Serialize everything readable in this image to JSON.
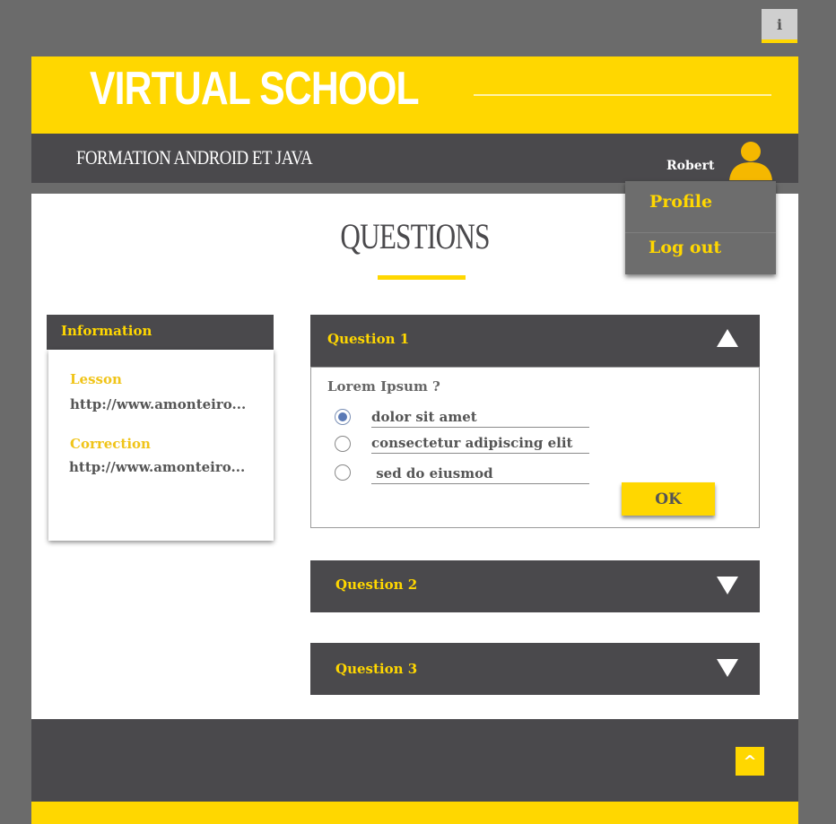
{
  "header": {
    "info_label": "i",
    "brand": "VIRTUAL SCHOOL",
    "course_title": "FORMATION ANDROID ET JAVA",
    "username": "Robert",
    "avatar_icon": "user-silhouette-icon"
  },
  "user_menu": {
    "items": [
      {
        "label": "Profile"
      },
      {
        "label": "Log out"
      }
    ]
  },
  "page": {
    "title": "QUESTIONS"
  },
  "info_panel": {
    "heading": "Information",
    "lesson_label": "Lesson",
    "lesson_link": "http://www.amonteiro...",
    "correction_label": "Correction",
    "correction_link": "http://www.amonteiro..."
  },
  "questions": [
    {
      "title": "Question 1",
      "expanded": true,
      "prompt": "Lorem Ipsum ?",
      "options": [
        {
          "label": "dolor sit amet",
          "selected": true
        },
        {
          "label": "consectetur adipiscing elit",
          "selected": false
        },
        {
          "label": " sed do eiusmod",
          "selected": false
        }
      ],
      "submit_label": "OK"
    },
    {
      "title": "Question 2",
      "expanded": false
    },
    {
      "title": "Question 3",
      "expanded": false
    }
  ],
  "footer": {
    "back_to_top_label": "^"
  },
  "colors": {
    "accent": "#ffd700",
    "dark": "#4a494c",
    "background": "#6b6b6b"
  }
}
